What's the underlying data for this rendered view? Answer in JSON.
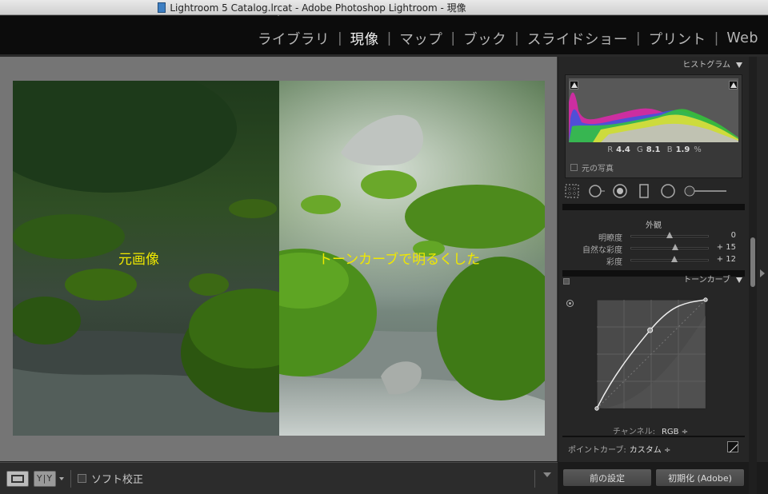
{
  "window": {
    "title": "Lightroom 5 Catalog.lrcat - Adobe Photoshop Lightroom - 現像"
  },
  "modules": [
    {
      "label": "ライブラリ",
      "active": false
    },
    {
      "label": "現像",
      "active": true
    },
    {
      "label": "マップ",
      "active": false
    },
    {
      "label": "ブック",
      "active": false
    },
    {
      "label": "スライドショー",
      "active": false
    },
    {
      "label": "プリント",
      "active": false
    },
    {
      "label": "Web",
      "active": false
    }
  ],
  "module_separator": "|",
  "photo": {
    "left_label": "元画像",
    "right_label": "トーンカーブで明るくした",
    "label_color": "#f0e800"
  },
  "toolbar": {
    "yy_label": "Y|Y",
    "soft_proof_label": "ソフト校正"
  },
  "histogram": {
    "header": "ヒストグラム",
    "r_label": "R",
    "r_value": "4.4",
    "g_label": "G",
    "g_value": "8.1",
    "b_label": "B",
    "b_value": "1.9",
    "percent": "%",
    "original_label": "元の写真"
  },
  "presence": {
    "header": "外観",
    "sliders": [
      {
        "label": "明瞭度",
        "value": "0",
        "position": 0.5
      },
      {
        "label": "自然な彩度",
        "value": "+ 15",
        "position": 0.575
      },
      {
        "label": "彩度",
        "value": "+ 12",
        "position": 0.56
      }
    ]
  },
  "tone_curve": {
    "header": "トーンカーブ",
    "channel_label": "チャンネル:",
    "channel_value": "RGB ÷",
    "point_curve_label": "ポイントカーブ:",
    "point_curve_value": "カスタム ÷",
    "points": [
      [
        0,
        0
      ],
      [
        0.49,
        0.72
      ],
      [
        1,
        1
      ]
    ]
  },
  "buttons": {
    "previous": "前の設定",
    "reset": "初期化 (Adobe)"
  },
  "colors": {
    "panel_bg": "#262626",
    "canvas_bg": "#757575",
    "accent_text": "#f0e800"
  }
}
